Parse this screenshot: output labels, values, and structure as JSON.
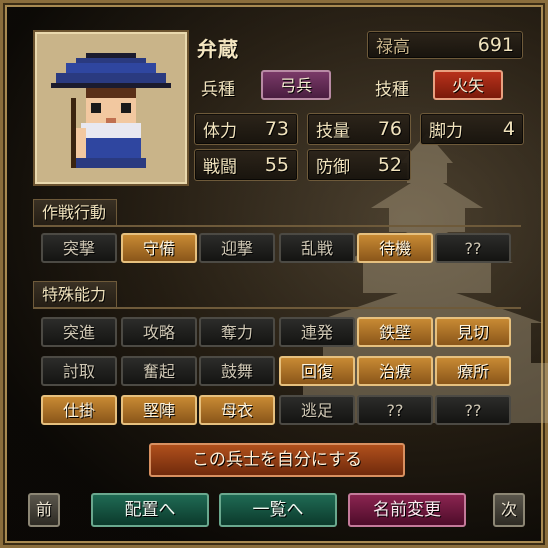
{
  "unit": {
    "name": "弁蔵",
    "salary_label": "禄高",
    "salary_value": "691",
    "type_label": "兵種",
    "type_value": "弓兵",
    "skill_label": "技種",
    "skill_value": "火矢"
  },
  "stats": [
    {
      "label": "体力",
      "value": "73"
    },
    {
      "label": "技量",
      "value": "76"
    },
    {
      "label": "脚力",
      "value": "4"
    },
    {
      "label": "戦闘",
      "value": "55"
    },
    {
      "label": "防御",
      "value": "52"
    }
  ],
  "tactics": {
    "title": "作戦行動",
    "buttons": [
      {
        "label": "突撃",
        "active": false
      },
      {
        "label": "守備",
        "active": true
      },
      {
        "label": "迎撃",
        "active": false
      },
      {
        "label": "乱戦",
        "active": false
      },
      {
        "label": "待機",
        "active": true
      },
      {
        "label": "??",
        "active": false
      }
    ]
  },
  "abilities": {
    "title": "特殊能力",
    "rows": [
      [
        {
          "label": "突進",
          "active": false
        },
        {
          "label": "攻略",
          "active": false
        },
        {
          "label": "奪力",
          "active": false
        },
        {
          "label": "連発",
          "active": false
        },
        {
          "label": "鉄壁",
          "active": true
        },
        {
          "label": "見切",
          "active": true
        }
      ],
      [
        {
          "label": "討取",
          "active": false
        },
        {
          "label": "奮起",
          "active": false
        },
        {
          "label": "鼓舞",
          "active": false
        },
        {
          "label": "回復",
          "active": true
        },
        {
          "label": "治療",
          "active": true
        },
        {
          "label": "療所",
          "active": true
        }
      ],
      [
        {
          "label": "仕掛",
          "active": true
        },
        {
          "label": "堅陣",
          "active": true
        },
        {
          "label": "母衣",
          "active": true
        },
        {
          "label": "逃足",
          "active": false
        },
        {
          "label": "??",
          "active": false
        },
        {
          "label": "??",
          "active": false
        }
      ]
    ]
  },
  "actions": {
    "make_own": "この兵士を自分にする",
    "prev": "前",
    "next": "次",
    "deploy": "配置へ",
    "list": "一覧へ",
    "rename": "名前変更"
  },
  "colors": {
    "active_button": "#c88a34",
    "inactive_button": "#1f1f1d",
    "type_tag": "#6a2e5a",
    "skill_tag": "#b02c18"
  },
  "icons": {
    "portrait": "archer-pixel-portrait",
    "background": "castle-silhouette"
  }
}
